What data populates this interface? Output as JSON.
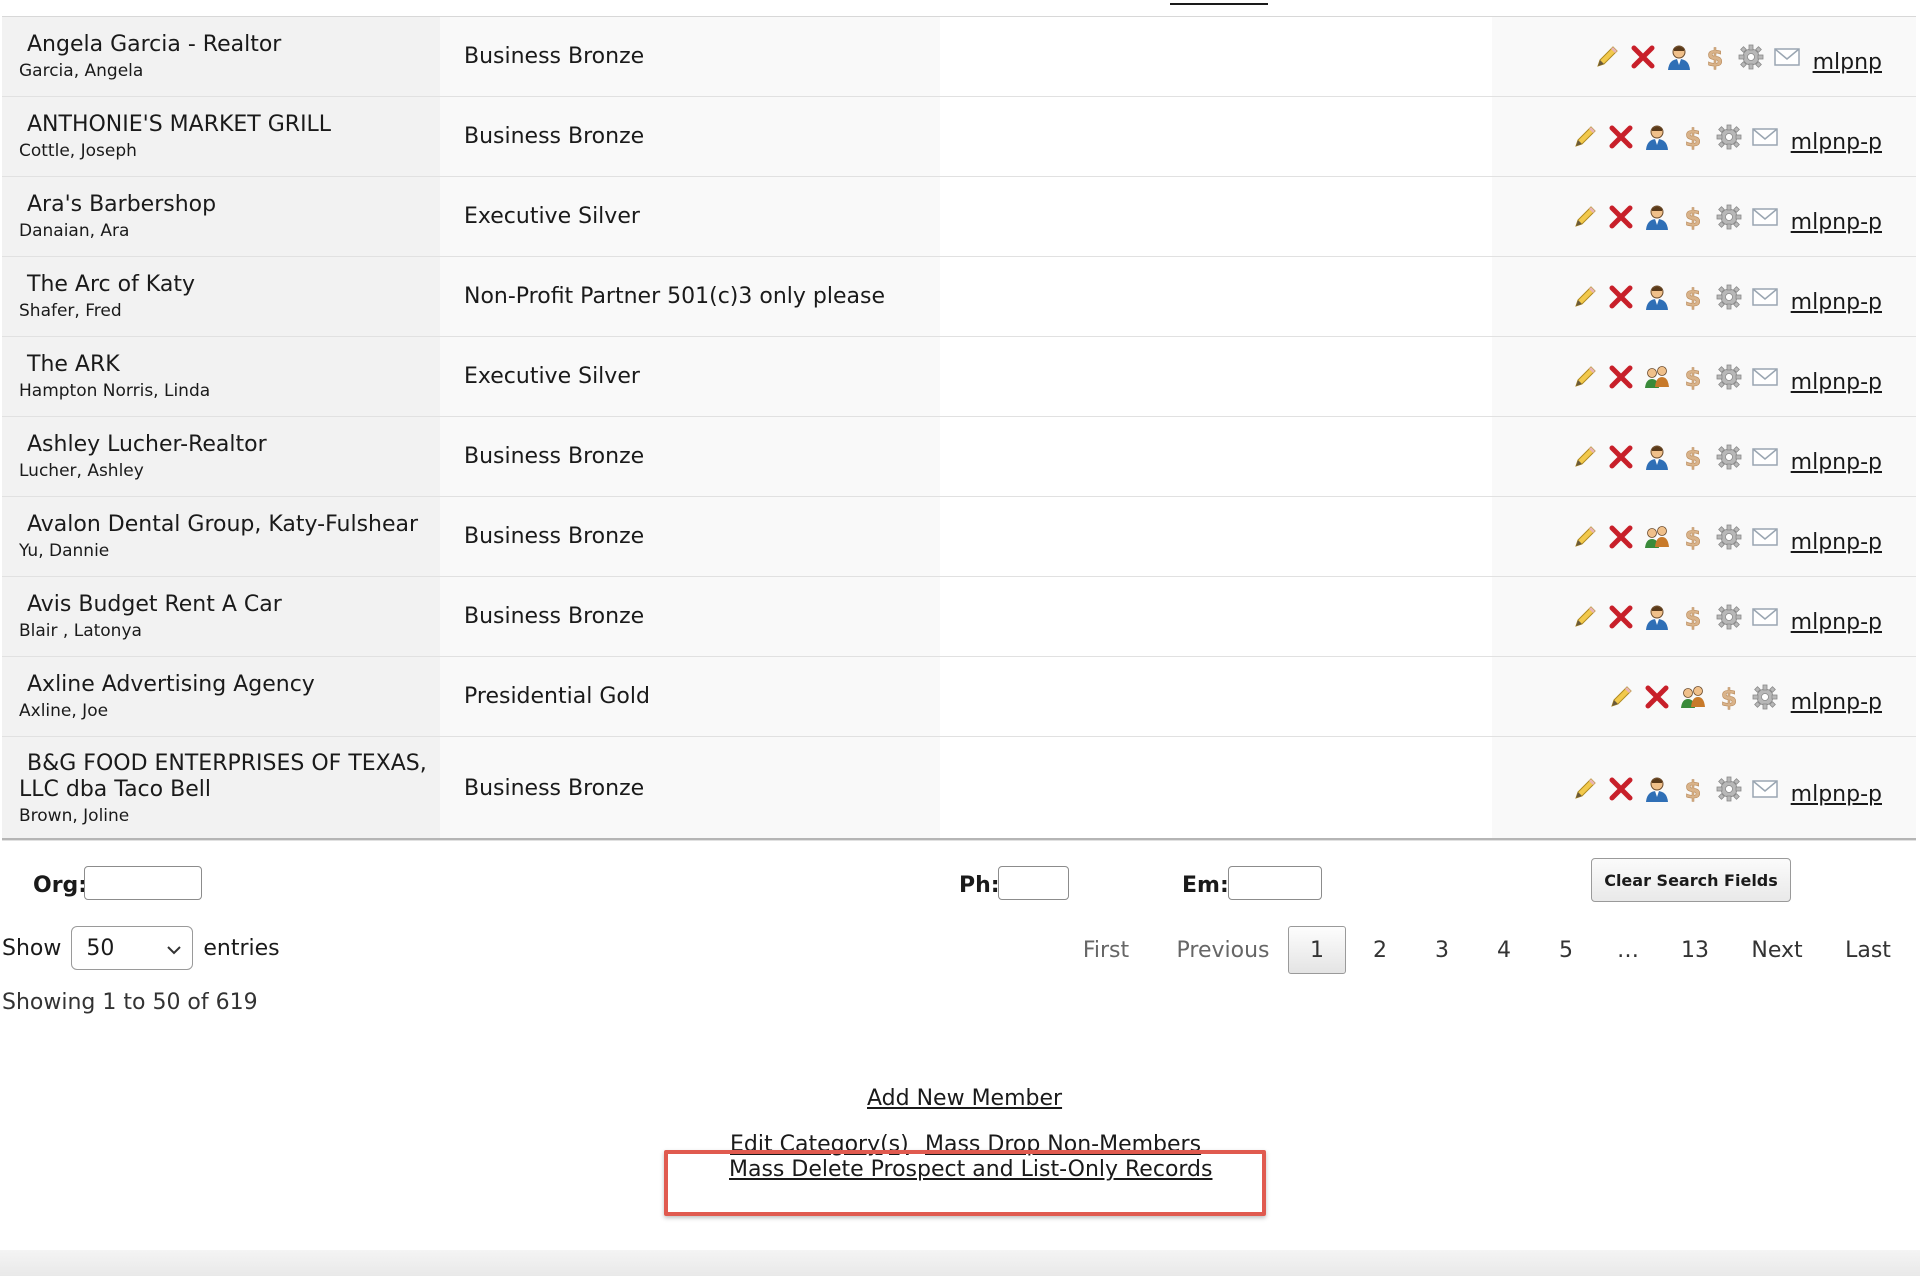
{
  "members": [
    {
      "org": "Angela Garcia - Realtor",
      "contact": "Garcia, Angela",
      "level": "Business Bronze",
      "profile_type": "single",
      "email": true,
      "account": "mlpnp"
    },
    {
      "org": "ANTHONIE'S MARKET GRILL",
      "contact": "Cottle, Joseph",
      "level": "Business Bronze",
      "profile_type": "single",
      "email": true,
      "account": "mlpnp-p"
    },
    {
      "org": "Ara's Barbershop",
      "contact": "Danaian, Ara",
      "level": "Executive Silver",
      "profile_type": "single",
      "email": true,
      "account": "mlpnp-p"
    },
    {
      "org": "The Arc of Katy",
      "contact": "Shafer, Fred",
      "level": "Non-Profit Partner 501(c)3 only please",
      "profile_type": "single",
      "email": true,
      "account": "mlpnp-p"
    },
    {
      "org": "The ARK",
      "contact": "Hampton Norris, Linda",
      "level": "Executive Silver",
      "profile_type": "group",
      "email": true,
      "account": "mlpnp-p"
    },
    {
      "org": "Ashley Lucher-Realtor",
      "contact": "Lucher, Ashley",
      "level": "Business Bronze",
      "profile_type": "single",
      "email": true,
      "account": "mlpnp-p"
    },
    {
      "org": "Avalon Dental Group, Katy-Fulshear",
      "contact": "Yu, Dannie",
      "level": "Business Bronze",
      "profile_type": "group",
      "email": true,
      "account": "mlpnp-p"
    },
    {
      "org": "Avis Budget Rent A Car",
      "contact": "Blair , Latonya",
      "level": "Business Bronze",
      "profile_type": "single",
      "email": true,
      "account": "mlpnp-p"
    },
    {
      "org": "Axline Advertising Agency",
      "contact": "Axline, Joe",
      "level": "Presidential Gold",
      "profile_type": "group",
      "email": false,
      "account": "mlpnp-p"
    },
    {
      "org": "B&G FOOD ENTERPRISES OF TEXAS, LLC dba Taco Bell",
      "org_line1": "B&G FOOD ENTERPRISES OF TEXAS,",
      "org_line2": "LLC dba Taco Bell",
      "contact": "Brown, Joline",
      "level": "Business Bronze",
      "profile_type": "single",
      "email": true,
      "account": "mlpnp-p"
    }
  ],
  "filters": {
    "org_label": "Org:",
    "phone_label": "Ph:",
    "email_label": "Em:",
    "org_value": "",
    "phone_value": "",
    "email_value": "",
    "clear_label": "Clear Search Fields"
  },
  "length": {
    "prefix": "Show",
    "value": "50",
    "suffix": "entries"
  },
  "pagination": {
    "first": "First",
    "previous": "Previous",
    "pages": [
      "1",
      "2",
      "3",
      "4",
      "5"
    ],
    "ellipsis": "…",
    "last_page": "13",
    "next": "Next",
    "last": "Last",
    "current": "1"
  },
  "info": "Showing 1 to 50 of 619",
  "links": {
    "add_member": "Add New Member",
    "edit_category": "Edit Category(s)",
    "mass_drop": "Mass Drop Non-Members",
    "mass_delete": "Mass Delete Prospect and List-Only Records"
  },
  "colors": {
    "highlight": "#e05a4f",
    "delete_icon": "#c8202a",
    "profile_icon": "#2f6fb6"
  },
  "icons": [
    "edit-pencil-icon",
    "delete-x-icon",
    "profile-icon",
    "billing-dollar-icon",
    "settings-gear-icon",
    "email-envelope-icon"
  ]
}
